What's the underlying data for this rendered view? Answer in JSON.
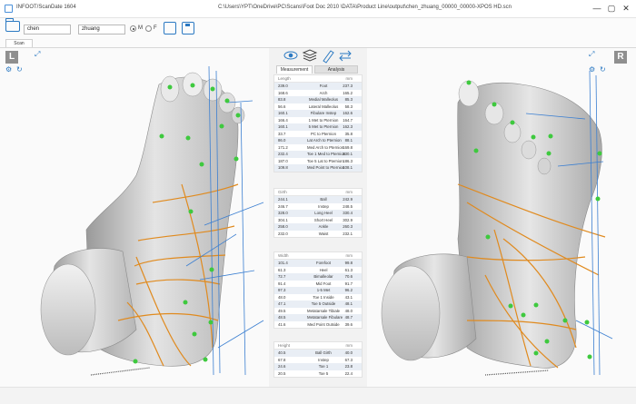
{
  "titlebar": {
    "app_name": "INFOOT/ScanDate 1604",
    "path": "C:\\Users\\YPT\\OneDrive\\PC\\Scans\\Foot Doc 2010 \\DATA\\Product Line\\output\\chen_zhuang_00000_00000-XPOS HD.scn",
    "min": "—",
    "max": "▢",
    "close": "✕"
  },
  "toolbar": {
    "last_name": "chen",
    "first_name": "zhuang",
    "radio_left": "M",
    "radio_right": "F",
    "tab_label": "Scan"
  },
  "left_view": {
    "corner_letter": "L"
  },
  "right_view": {
    "corner_letter": "R"
  },
  "panel": {
    "tab_measurement": "Measurement",
    "tab_analysis": "Analysis",
    "length_table": {
      "header": [
        "Length",
        "",
        "mm"
      ],
      "rows": [
        [
          "239.0",
          "Foot",
          "237.3"
        ],
        [
          "168.6",
          "Arch",
          "165.2"
        ],
        [
          "83.8",
          "Medial Malleolus",
          "85.3"
        ],
        [
          "56.6",
          "Lateral Malleolus",
          "58.3"
        ],
        [
          "160.1",
          "Fibulare Instep",
          "162.6"
        ],
        [
          "166.4",
          "1 Met to Pternion",
          "164.7"
        ],
        [
          "160.1",
          "5 Met to Pternion",
          "162.3"
        ],
        [
          "33.7",
          "PC to Pternion",
          "35.8"
        ],
        [
          "86.0",
          "Lat Arch to Pternion",
          "88.1"
        ],
        [
          "171.2",
          "Med Arch to Pternion",
          "169.8"
        ],
        [
          "232.4",
          "Toe 1 Med to Pternion",
          "230.1"
        ],
        [
          "187.0",
          "Toe 5 Lat to Pternion",
          "186.3"
        ],
        [
          "109.8",
          "Med Point to Pternion",
          "108.1"
        ]
      ]
    },
    "girth_table": {
      "header": [
        "Girth",
        "",
        "mm"
      ],
      "rows": [
        [
          "244.1",
          "Ball",
          "242.9"
        ],
        [
          "246.7",
          "Instep",
          "248.5"
        ],
        [
          "328.0",
          "Long Heel",
          "330.4"
        ],
        [
          "304.1",
          "Short Heel",
          "302.9"
        ],
        [
          "258.0",
          "Ankle",
          "260.3"
        ],
        [
          "232.0",
          "Waist",
          "232.1"
        ]
      ]
    },
    "width_table": {
      "header": [
        "Width",
        "",
        "mm"
      ],
      "rows": [
        [
          "101.4",
          "Forefoot",
          "99.8"
        ],
        [
          "61.3",
          "Heel",
          "61.3"
        ],
        [
          "72.7",
          "Bimalleolar",
          "70.6"
        ],
        [
          "91.4",
          "Mid Foot",
          "91.7"
        ],
        [
          "97.3",
          "1-5 Met",
          "96.2"
        ],
        [
          "48.0",
          "Toe 1 Inside",
          "43.1"
        ],
        [
          "47.1",
          "Toe 5 Outside",
          "48.1"
        ],
        [
          "49.5",
          "Metatarsale Tibiale",
          "48.0"
        ],
        [
          "48.5",
          "Metatarsale Fibulare",
          "48.7"
        ],
        [
          "41.6",
          "Med Point Outside",
          "39.6"
        ]
      ]
    },
    "height_table": {
      "header": [
        "Height",
        "",
        "mm"
      ],
      "rows": [
        [
          "40.5",
          "Ball Girth",
          "40.0"
        ],
        [
          "67.8",
          "Instep",
          "67.3"
        ],
        [
          "24.6",
          "Toe 1",
          "23.8"
        ],
        [
          "20.5",
          "Toe 5",
          "22.4"
        ]
      ]
    }
  },
  "colors": {
    "accent": "#2b79c2",
    "landmark": "#3ec93e",
    "contour": "#e08a1e",
    "axis": "#3b7fd1"
  }
}
